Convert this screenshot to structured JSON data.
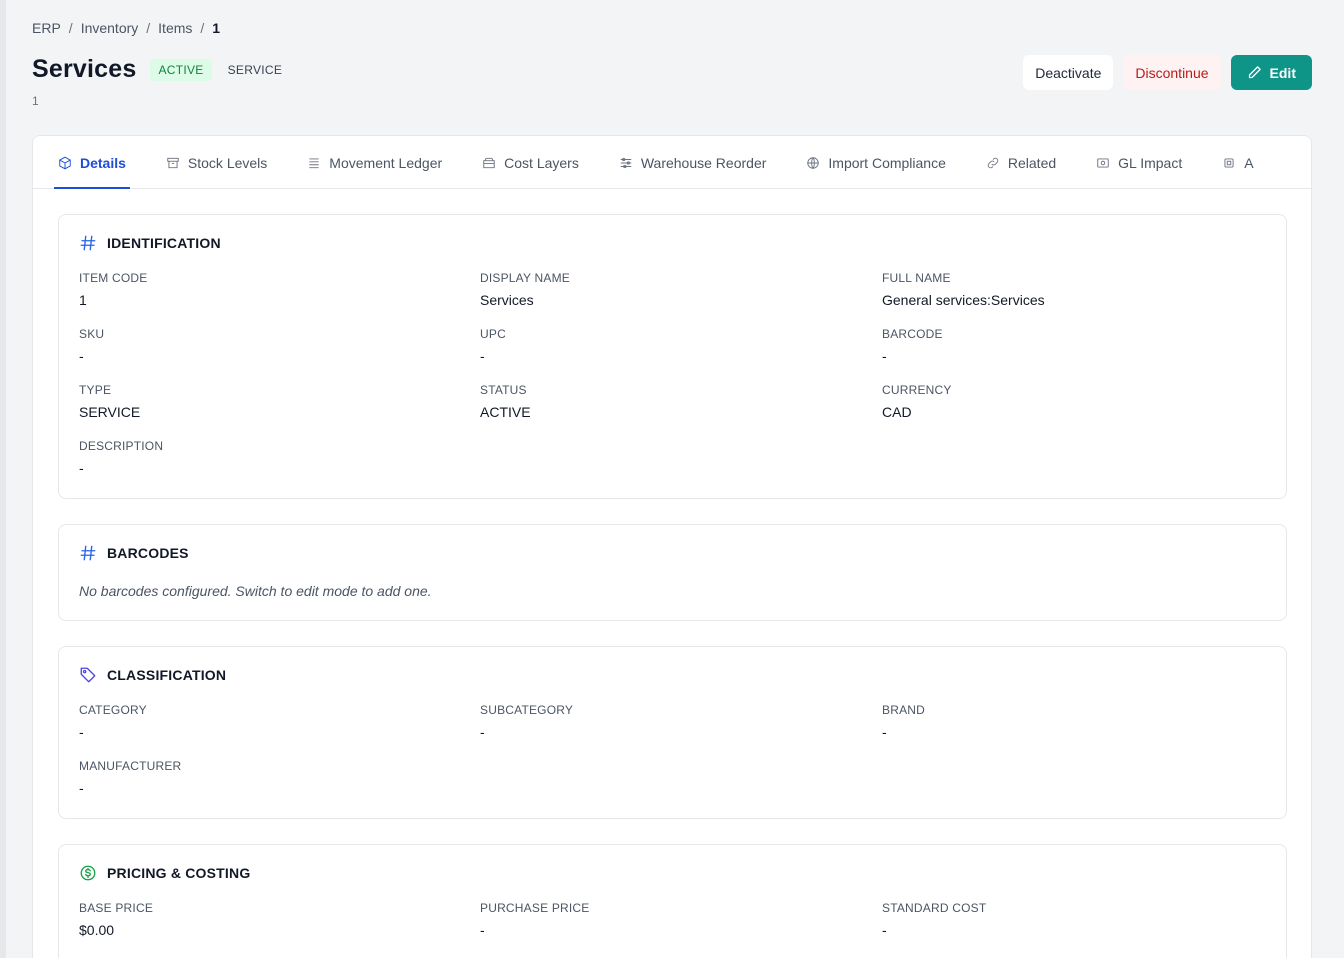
{
  "breadcrumb": [
    "ERP",
    "Inventory",
    "Items",
    "1"
  ],
  "breadcrumb_sep": "/",
  "header": {
    "title": "Services",
    "status_badge": "ACTIVE",
    "type_badge": "SERVICE",
    "subtitle": "1"
  },
  "actions": {
    "deactivate": "Deactivate",
    "discontinue": "Discontinue",
    "edit": "Edit"
  },
  "tabs": [
    {
      "label": "Details",
      "icon": "box-icon"
    },
    {
      "label": "Stock Levels",
      "icon": "archive-icon"
    },
    {
      "label": "Movement Ledger",
      "icon": "list-icon"
    },
    {
      "label": "Cost Layers",
      "icon": "layers-icon"
    },
    {
      "label": "Warehouse Reorder",
      "icon": "sliders-icon"
    },
    {
      "label": "Import Compliance",
      "icon": "globe-icon"
    },
    {
      "label": "Related",
      "icon": "link-icon"
    },
    {
      "label": "GL Impact",
      "icon": "receipt-icon"
    },
    {
      "label": "A",
      "icon": "chip-icon"
    }
  ],
  "identification": {
    "title": "IDENTIFICATION",
    "fields": [
      {
        "label": "ITEM CODE",
        "value": "1"
      },
      {
        "label": "DISPLAY NAME",
        "value": "Services"
      },
      {
        "label": "FULL NAME",
        "value": "General services:Services"
      },
      {
        "label": "SKU",
        "value": "-"
      },
      {
        "label": "UPC",
        "value": "-"
      },
      {
        "label": "BARCODE",
        "value": "-"
      },
      {
        "label": "TYPE",
        "value": "SERVICE"
      },
      {
        "label": "STATUS",
        "value": "ACTIVE"
      },
      {
        "label": "CURRENCY",
        "value": "CAD"
      },
      {
        "label": "DESCRIPTION",
        "value": "-"
      }
    ]
  },
  "barcodes": {
    "title": "BARCODES",
    "empty": "No barcodes configured. Switch to edit mode to add one."
  },
  "classification": {
    "title": "CLASSIFICATION",
    "fields": [
      {
        "label": "CATEGORY",
        "value": "-"
      },
      {
        "label": "SUBCATEGORY",
        "value": "-"
      },
      {
        "label": "BRAND",
        "value": "-"
      },
      {
        "label": "MANUFACTURER",
        "value": "-"
      }
    ]
  },
  "pricing": {
    "title": "PRICING & COSTING",
    "fields": [
      {
        "label": "BASE PRICE",
        "value": "$0.00"
      },
      {
        "label": "PURCHASE PRICE",
        "value": "-"
      },
      {
        "label": "STANDARD COST",
        "value": "-"
      }
    ]
  },
  "colors": {
    "accent": "#1d4ed8",
    "edit_button": "#0f9488",
    "active_badge_bg": "#dcfce7",
    "danger": "#b91c1c"
  }
}
